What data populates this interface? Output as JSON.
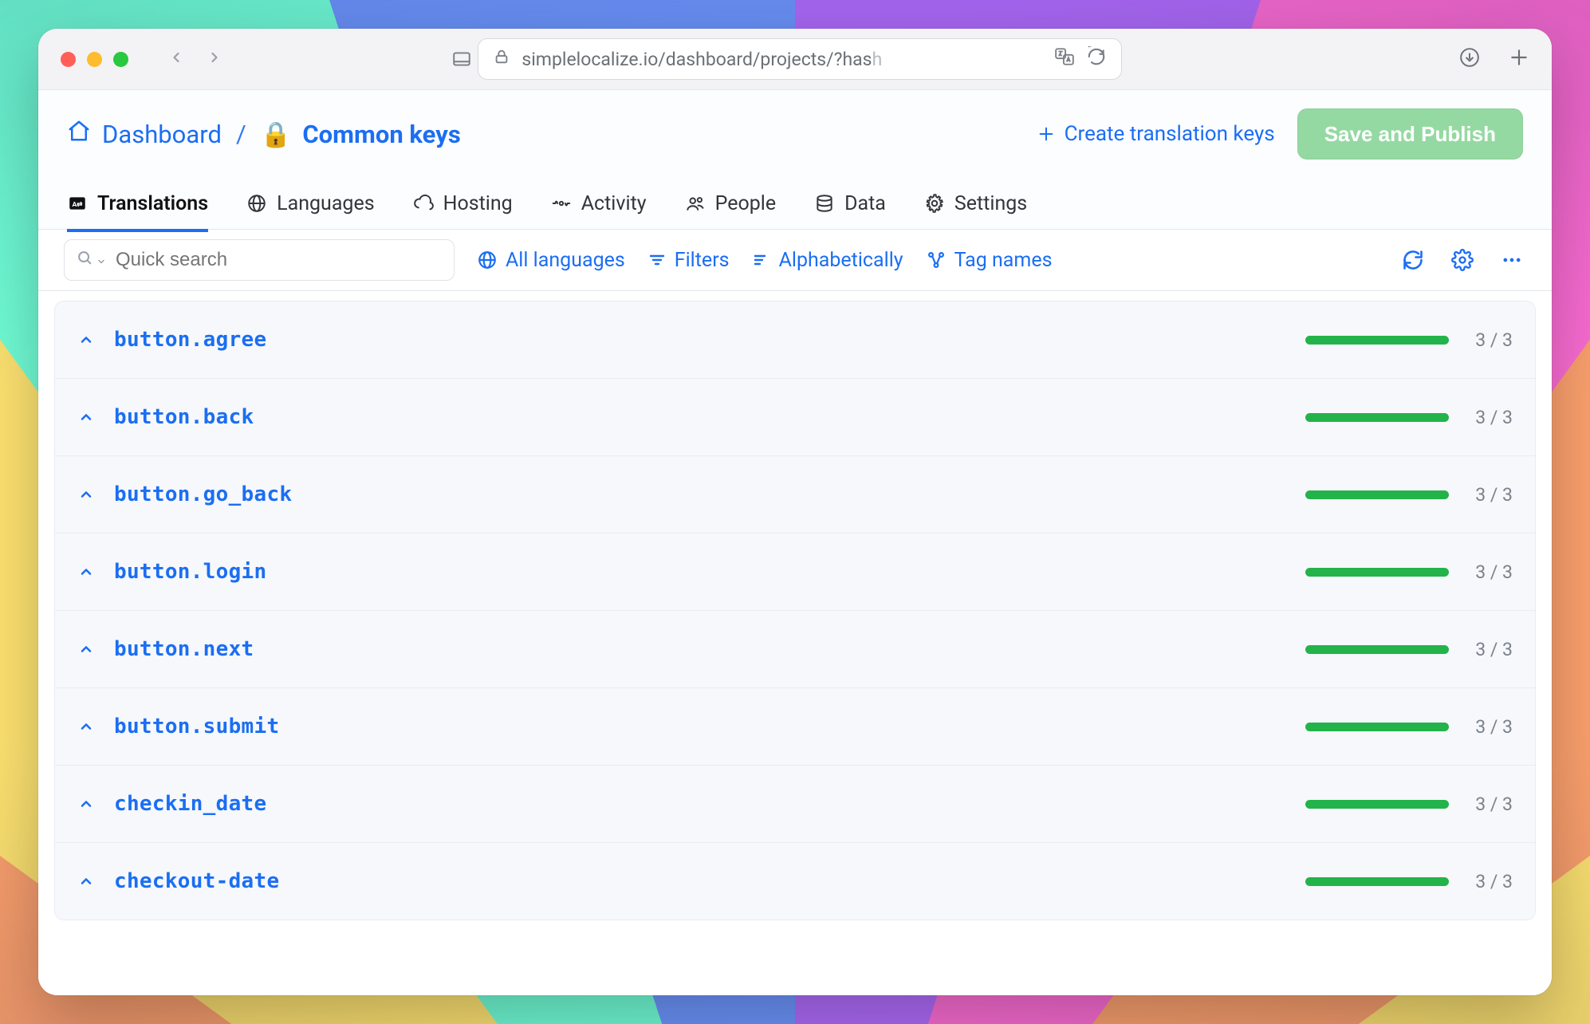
{
  "browser": {
    "url_display_prefix": "simplelocalize.io/dashboard/projects/?has",
    "url_display_fade": "h"
  },
  "breadcrumb": {
    "dashboard_label": "Dashboard",
    "separator": "/",
    "project_emoji": "🔒",
    "project_name": "Common keys"
  },
  "actions": {
    "create_keys": "Create translation keys",
    "save_publish": "Save and Publish"
  },
  "tabs": [
    {
      "id": "translations",
      "label": "Translations"
    },
    {
      "id": "languages",
      "label": "Languages"
    },
    {
      "id": "hosting",
      "label": "Hosting"
    },
    {
      "id": "activity",
      "label": "Activity"
    },
    {
      "id": "people",
      "label": "People"
    },
    {
      "id": "data",
      "label": "Data"
    },
    {
      "id": "settings",
      "label": "Settings"
    }
  ],
  "toolbar": {
    "search_placeholder": "Quick search",
    "all_languages": "All languages",
    "filters": "Filters",
    "sort": "Alphabetically",
    "tag_mode": "Tag names"
  },
  "keys": [
    {
      "name": "button.agree",
      "done": 3,
      "total": 3
    },
    {
      "name": "button.back",
      "done": 3,
      "total": 3
    },
    {
      "name": "button.go_back",
      "done": 3,
      "total": 3
    },
    {
      "name": "button.login",
      "done": 3,
      "total": 3
    },
    {
      "name": "button.next",
      "done": 3,
      "total": 3
    },
    {
      "name": "button.submit",
      "done": 3,
      "total": 3
    },
    {
      "name": "checkin_date",
      "done": 3,
      "total": 3
    },
    {
      "name": "checkout-date",
      "done": 3,
      "total": 3
    }
  ]
}
